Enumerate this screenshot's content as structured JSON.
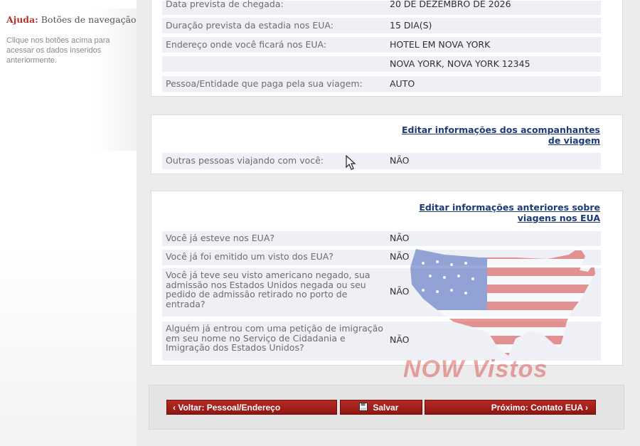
{
  "help": {
    "title_strong": "Ajuda:",
    "title_rest": " Botões de navegação",
    "text": "Clique nos botões acima para acessar os dados inseridos anteriormente."
  },
  "travel": {
    "rows": [
      {
        "label": "Data prevista de chegada:",
        "value": "20 DE DEZEMBRO DE 2026"
      },
      {
        "label": "Duração prevista da estadia nos EUA:",
        "value": "15 DIA(S)"
      },
      {
        "label": "Endereço onde você ficará nos EUA:",
        "value": "HOTEL EM NOVA YORK"
      },
      {
        "label": "",
        "value": "NOVA YORK, NOVA YORK 12345"
      },
      {
        "label": "Pessoa/Entidade que paga pela sua viagem:",
        "value": "AUTO"
      }
    ]
  },
  "companions": {
    "edit_link_line1": "Editar informações dos acompanhantes",
    "edit_link_line2": "de viagem",
    "rows": [
      {
        "label": "Outras pessoas viajando com você:",
        "value": "NÃO"
      }
    ]
  },
  "previous": {
    "edit_link_line1": "Editar informações anteriores sobre",
    "edit_link_line2": "viagens nos EUA",
    "rows": [
      {
        "label": "Você já esteve nos EUA?",
        "value": "NÃO"
      },
      {
        "label": "Você já foi emitido um visto dos EUA?",
        "value": "NÃO"
      },
      {
        "label": "Você já teve seu visto americano negado, sua admissão nos Estados Unidos negada ou seu pedido de admissão retirado no porto de entrada?",
        "value": "NÃO"
      },
      {
        "label": "Alguém já entrou com uma petição de imigração em seu nome no Serviço de Cidadania e Imigração dos Estados Unidos?",
        "value": "NÃO"
      }
    ]
  },
  "nav": {
    "back_label": "Voltar: Pessoal/Endereço",
    "save_label": "Salvar",
    "next_label": "Próximo: Contato EUA"
  },
  "watermark": {
    "text": "NOW Vistos",
    "color": "#d63c38"
  },
  "icons": {
    "back": "chevron-left-icon",
    "save": "floppy-disk-icon",
    "next": "chevron-right-icon",
    "cursor": "mouse-pointer-icon"
  }
}
